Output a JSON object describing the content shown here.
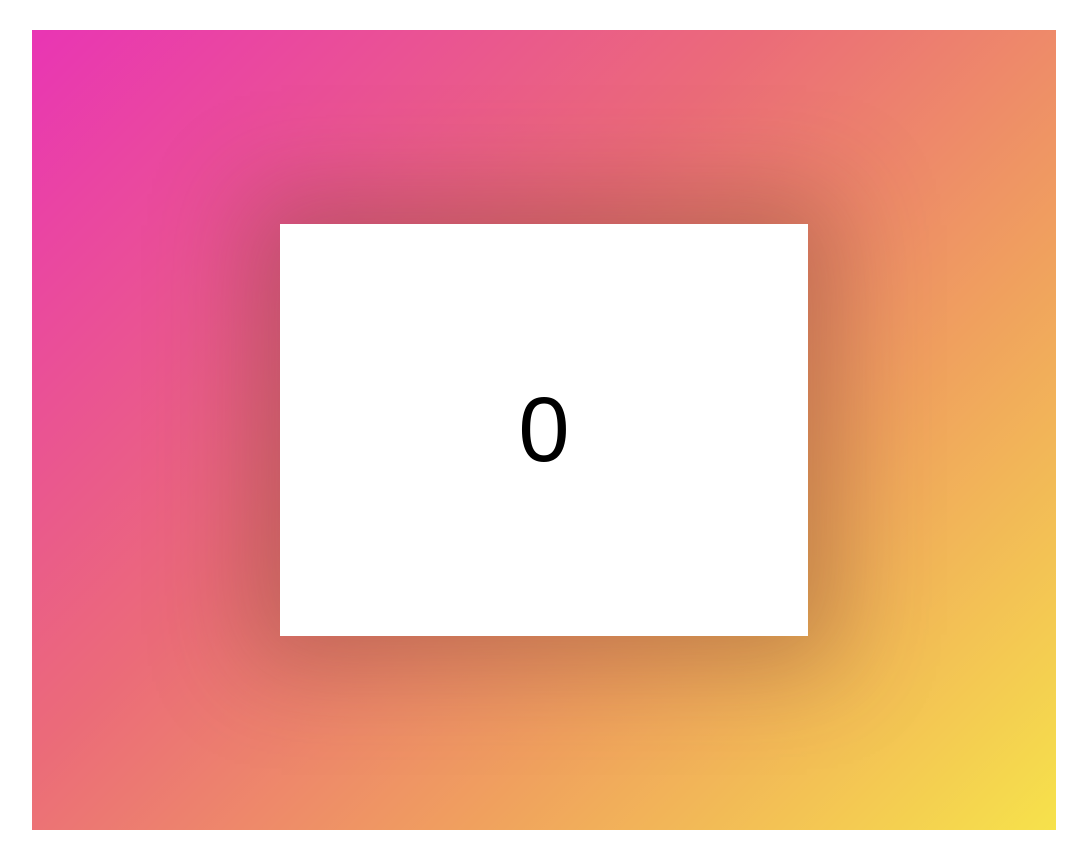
{
  "counter": {
    "value": "0"
  },
  "colors": {
    "gradient_start": "#e935b4",
    "gradient_mid_pink": "#eb6b79",
    "gradient_mid_orange": "#f0a15e",
    "gradient_end": "#f6e24b",
    "card_background": "#ffffff",
    "text": "#000000"
  }
}
